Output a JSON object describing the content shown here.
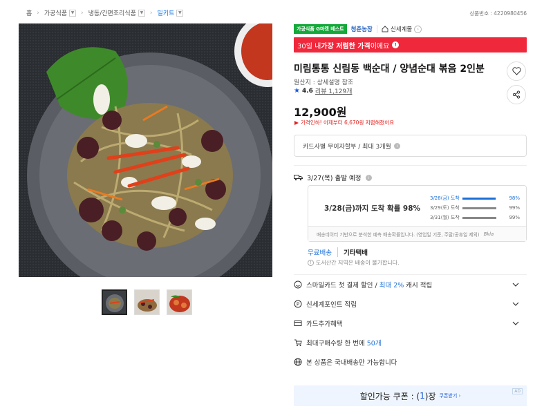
{
  "breadcrumb": {
    "items": [
      {
        "label": "홈"
      },
      {
        "label": "가공식품"
      },
      {
        "label": "냉동/간편조리식품"
      },
      {
        "label": "밀키트"
      }
    ],
    "product_no": "상품번호 : 4220980456"
  },
  "badges": {
    "gmarket": "가공식품 G마켓 베스트",
    "farm": "청춘농장",
    "shop": "신세계몰"
  },
  "promo": {
    "prefix": "30일 내 ",
    "bold": "가장 저렴한 가격",
    "suffix": "이에요"
  },
  "product": {
    "title": "미림통통 신림동 백순대 / 양념순대 볶음 2인분",
    "origin": "원산지 : 상세설명 참조",
    "rating": "4.6",
    "review_label": "리뷰",
    "review_count": "1,129개",
    "price": "12,900원",
    "price_note": "가격인하! 어제부터 6,670원 저렴해졌어요"
  },
  "card_info": "카드사별 무이자할부 / 최대 3개월",
  "shipping": {
    "date": "3/27(목) 출발 예정",
    "prob_title": "3/28(금)까지 도착 확률 98%",
    "rows": [
      {
        "date": "3/28(금) 도착",
        "pct": "98%",
        "value": 98
      },
      {
        "date": "3/29(토) 도착",
        "pct": "99%",
        "value": 99
      },
      {
        "date": "3/31(월) 도착",
        "pct": "99%",
        "value": 99
      }
    ],
    "footnote": "배송데이터 기반으로 분석한 예측 배송확률입니다. (영업일 기준, 주말/공휴일 제외)",
    "footnote_brand": "Bkla",
    "free": "무료배송",
    "other": "기타택배",
    "note": "도서산간 지역은 배송이 불가합니다."
  },
  "benefits": {
    "smile_prefix": "스마일카드 첫 결제 할인 / ",
    "smile_hl": "최대 2%",
    "smile_suffix": " 캐시 적립",
    "point": "신세계포인트 적립",
    "card": "카드추가혜택",
    "max_prefix": "최대구매수량 한 번에 ",
    "max_hl": "50개",
    "domestic": "본 상품은 국내배송만 가능합니다"
  },
  "coupon": {
    "prefix": "할인가능 쿠폰 : (",
    "count": "1",
    "suffix": ")장",
    "get": "쿠폰받기 ›",
    "tag": "AD"
  },
  "colors": {
    "promo": "#f0283c",
    "accent": "#1a6fd8",
    "gmarket": "#15a83a"
  }
}
